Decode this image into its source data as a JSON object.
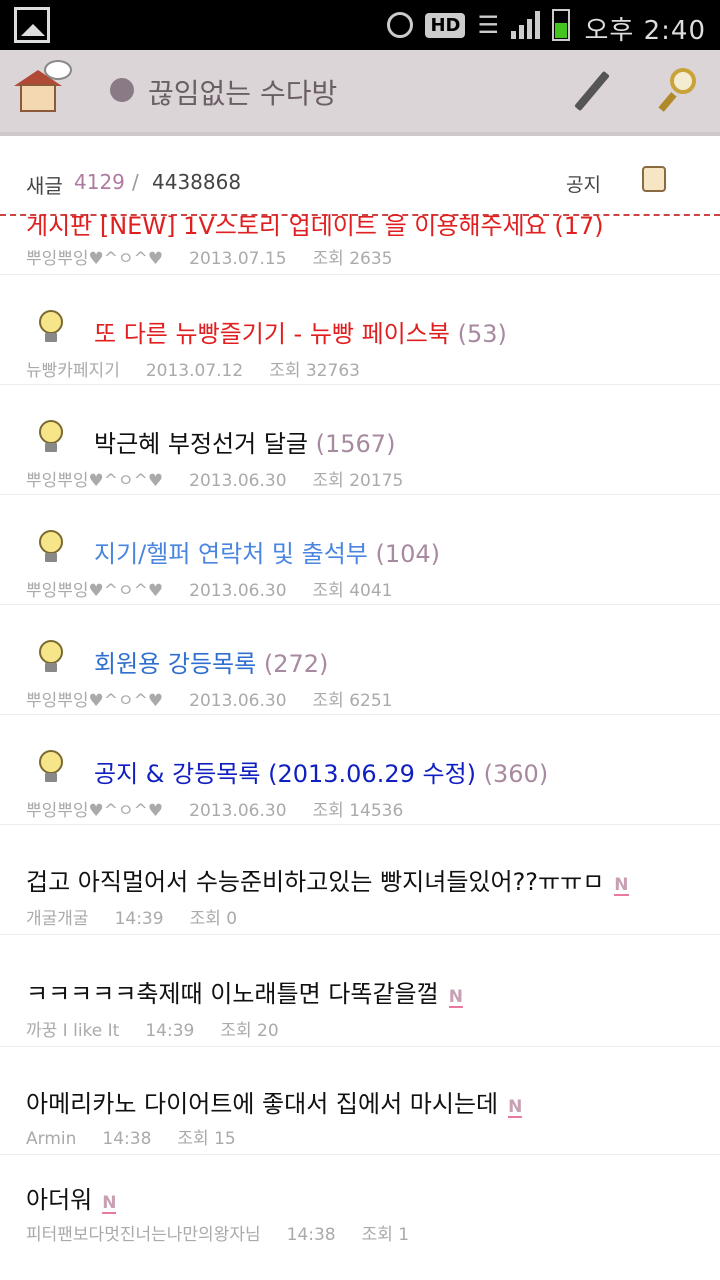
{
  "status_bar": {
    "hd_label": "HD",
    "time": "오후 2:40",
    "battery_color": "#44c41e"
  },
  "header": {
    "title": "끊임없는 수다방",
    "home_icon": "home-icon",
    "write_icon": "pencil-icon",
    "search_icon": "search-icon",
    "background": "#dbd5d8"
  },
  "counts": {
    "new_label": "새글",
    "new_count": "4129",
    "separator": "/",
    "total_count": "4438868",
    "notice_label": "공지"
  },
  "posts": [
    {
      "title": "게시판 [NEW] 1V스토리 업데이트 을 이용해주세요",
      "comments": "(17)",
      "author": "뿌잉뿌잉♥^ㅇ^♥",
      "date": "2013.07.15",
      "views": "조회 2635",
      "color": "#e02020",
      "notice": true
    },
    {
      "title": "또 다른 뉴빵즐기기 - 뉴빵 페이스북",
      "comments": "(53)",
      "author": "뉴빵카페지기",
      "date": "2013.07.12",
      "views": "조회 32763",
      "color": "#e02020",
      "notice": true
    },
    {
      "title": "박근혜 부정선거 달글",
      "comments": "(1567)",
      "author": "뿌잉뿌잉♥^ㅇ^♥",
      "date": "2013.06.30",
      "views": "조회 20175",
      "color": "#111111",
      "notice": true
    },
    {
      "title": "지기/헬퍼 연락처 및 출석부",
      "comments": "(104)",
      "author": "뿌잉뿌잉♥^ㅇ^♥",
      "date": "2013.06.30",
      "views": "조회 4041",
      "color": "#4a86e0",
      "notice": true
    },
    {
      "title": "회원용 강등목록",
      "comments": "(272)",
      "author": "뿌잉뿌잉♥^ㅇ^♥",
      "date": "2013.06.30",
      "views": "조회 6251",
      "color": "#2f6fd0",
      "notice": true
    },
    {
      "title": "공지 & 강등목록 (2013.06.29 수정)",
      "comments": "(360)",
      "author": "뿌잉뿌잉♥^ㅇ^♥",
      "date": "2013.06.30",
      "views": "조회 14536",
      "color": "#1020c0",
      "notice": true
    },
    {
      "title": "겁고 아직멀어서 수능준비하고있는 빵지녀들있어??ㅠㅠㅁ",
      "badge": "N",
      "author": "개굴개굴",
      "date": "14:39",
      "views": "조회 0",
      "color": "#111111",
      "notice": false
    },
    {
      "title": "ㅋㅋㅋㅋㅋ축제때 이노래틀면 다똑같을껄",
      "badge": "N",
      "author": "까꿍 I like It",
      "date": "14:39",
      "views": "조회 20",
      "color": "#111111",
      "notice": false
    },
    {
      "title": "아메리카노 다이어트에 좋대서 집에서 마시는데",
      "badge": "N",
      "author": "Armin",
      "date": "14:38",
      "views": "조회 15",
      "color": "#111111",
      "notice": false
    },
    {
      "title": "아더워",
      "badge": "N",
      "author": "피터팬보다멋진너는나만의왕자님",
      "date": "14:38",
      "views": "조회 1",
      "color": "#111111",
      "notice": false
    }
  ]
}
